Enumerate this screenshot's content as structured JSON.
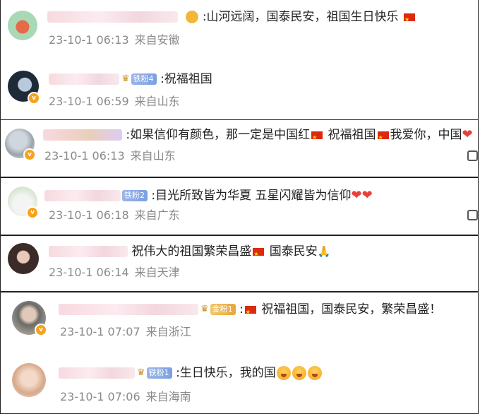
{
  "comments": [
    {
      "badge": "",
      "text": ":山河远阔，国泰民安，祖国生日快乐",
      "date": "23-10-1 06:13",
      "location": "来自安徽"
    },
    {
      "badge": "铁粉4",
      "text": ":祝福祖国",
      "date": "23-10-1 06:59",
      "location": "来自山东"
    },
    {
      "badge": "",
      "text_a": ":如果信仰有颜色，那一定是中国红",
      "text_b": " 祝福祖国",
      "text_c": "我爱你，中国",
      "date": "23-10-1 06:13",
      "location": "来自山东"
    },
    {
      "badge": "铁粉2",
      "text": ":目光所致皆为华夏 五星闪耀皆为信仰",
      "date": "23-10-1 06:18",
      "location": "来自广东"
    },
    {
      "badge": "",
      "text_a": "祝伟大的祖国繁荣昌盛",
      "text_b": " 国泰民安",
      "date": "23-10-1 06:14",
      "location": "来自天津"
    },
    {
      "badge": "金粉1",
      "text": " 祝福祖国，国泰民安，繁荣昌盛！",
      "date": "23-10-1 07:07",
      "location": "来自浙江"
    },
    {
      "badge": "铁粉1",
      "text": ":生日快乐，我的国",
      "date": "23-10-1 07:06",
      "location": "来自海南"
    }
  ],
  "icons": {
    "verified": "verified-badge-icon",
    "flag": "china-flag-icon",
    "heart": "red-heart-icon",
    "reply": "reply-icon"
  },
  "colors": {
    "meta_text": "#8a8a8a",
    "flag_red": "#de2910",
    "badge_blue": "#7aa0e3",
    "badge_gold": "#e7a73b"
  }
}
